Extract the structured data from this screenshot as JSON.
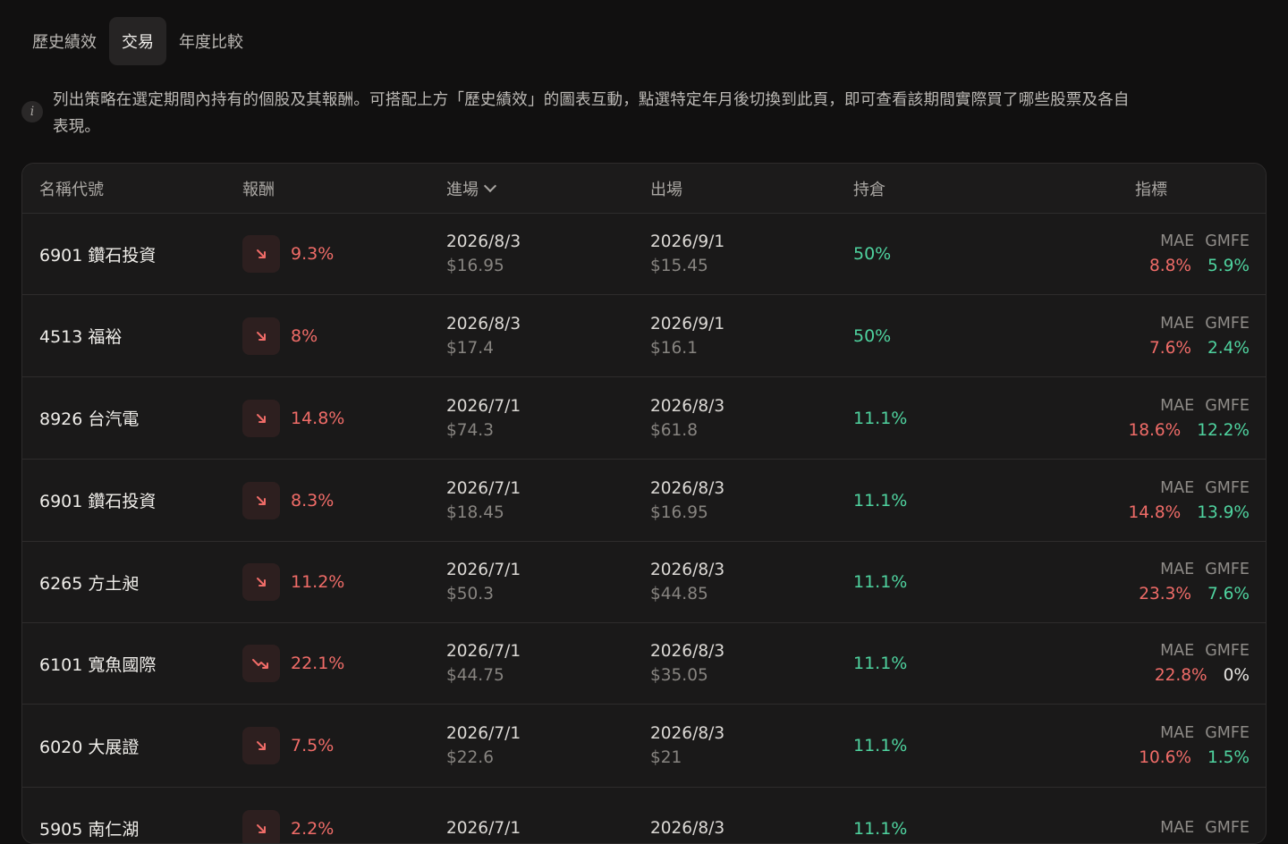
{
  "tabs": [
    {
      "label": "歷史績效",
      "active": false
    },
    {
      "label": "交易",
      "active": true
    },
    {
      "label": "年度比較",
      "active": false
    }
  ],
  "info": {
    "icon": "info-icon",
    "glyph": "i",
    "line1": "列出策略在選定期間內持有的個股及其報酬。可搭配上方「歷史績效」的圖表互動，點選特定年月後切換到此頁，即可查看該期間實際買了哪些股票及各自",
    "line2": "表現。"
  },
  "table": {
    "columns": {
      "name": "名稱代號",
      "return": "報酬",
      "entry": "進場",
      "exit": "出場",
      "holding": "持倉",
      "indicators": "指標"
    },
    "indicator_labels": {
      "mae": "MAE",
      "gmfe": "GMFE"
    },
    "rows": [
      {
        "name": "6901 鑽石投資",
        "return": "9.3%",
        "icon": "trend-down-icon",
        "entry_date": "2026/8/3",
        "entry_price": "$16.95",
        "exit_date": "2026/9/1",
        "exit_price": "$15.45",
        "holding": "50%",
        "mae": "8.8%",
        "gmfe": "5.9%"
      },
      {
        "name": "4513 福裕",
        "return": "8%",
        "icon": "trend-down-icon",
        "entry_date": "2026/8/3",
        "entry_price": "$17.4",
        "exit_date": "2026/9/1",
        "exit_price": "$16.1",
        "holding": "50%",
        "mae": "7.6%",
        "gmfe": "2.4%"
      },
      {
        "name": "8926 台汽電",
        "return": "14.8%",
        "icon": "trend-down-icon",
        "entry_date": "2026/7/1",
        "entry_price": "$74.3",
        "exit_date": "2026/8/3",
        "exit_price": "$61.8",
        "holding": "11.1%",
        "mae": "18.6%",
        "gmfe": "12.2%"
      },
      {
        "name": "6901 鑽石投資",
        "return": "8.3%",
        "icon": "trend-down-icon",
        "entry_date": "2026/7/1",
        "entry_price": "$18.45",
        "exit_date": "2026/8/3",
        "exit_price": "$16.95",
        "holding": "11.1%",
        "mae": "14.8%",
        "gmfe": "13.9%"
      },
      {
        "name": "6265 方土昶",
        "return": "11.2%",
        "icon": "trend-down-icon",
        "entry_date": "2026/7/1",
        "entry_price": "$50.3",
        "exit_date": "2026/8/3",
        "exit_price": "$44.85",
        "holding": "11.1%",
        "mae": "23.3%",
        "gmfe": "7.6%"
      },
      {
        "name": "6101 寬魚國際",
        "return": "22.1%",
        "icon": "trend-down-strong-icon",
        "entry_date": "2026/7/1",
        "entry_price": "$44.75",
        "exit_date": "2026/8/3",
        "exit_price": "$35.05",
        "holding": "11.1%",
        "mae": "22.8%",
        "gmfe": "0%"
      },
      {
        "name": "6020 大展證",
        "return": "7.5%",
        "icon": "trend-down-icon",
        "entry_date": "2026/7/1",
        "entry_price": "$22.6",
        "exit_date": "2026/8/3",
        "exit_price": "$21",
        "holding": "11.1%",
        "mae": "10.6%",
        "gmfe": "1.5%"
      },
      {
        "name": "5905 南仁湖",
        "return": "2.2%",
        "icon": "trend-down-icon",
        "entry_date": "2026/7/1",
        "entry_price": "",
        "exit_date": "2026/8/3",
        "exit_price": "",
        "holding": "11.1%",
        "mae": "",
        "gmfe": ""
      }
    ]
  },
  "colors": {
    "background": "#111010",
    "negative": "#f06c68",
    "positive": "#4fd39f"
  }
}
